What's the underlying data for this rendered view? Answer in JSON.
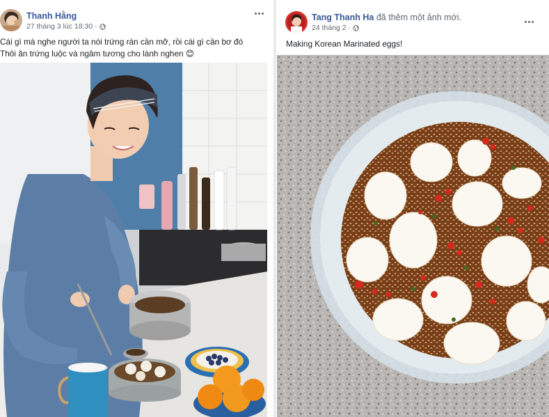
{
  "posts": [
    {
      "author": "Thanh Hằng",
      "action": "",
      "timestamp": "27 tháng 3 lúc 18:30",
      "separator": "·",
      "audience_icon": "globe-icon",
      "menu_icon": "more-options-icon",
      "caption_lines": [
        "Cái gì mà nghe người ta nói trứng rán cần mỡ, rồi cái gì cần bơ đó",
        "Thôi ăn trứng luộc và ngâm tương cho lành nghen 😊"
      ],
      "photo_icon": "kitchen-cooking-photo"
    },
    {
      "author": "Tang Thanh Ha",
      "action": "đã thêm một ảnh mới.",
      "timestamp": "24 tháng 2",
      "separator": "·",
      "audience_icon": "globe-icon",
      "menu_icon": "more-options-icon",
      "caption_lines": [
        "Making Korean Marinated eggs!"
      ],
      "photo_icon": "marinated-eggs-photo"
    }
  ],
  "colors": {
    "author_link": "#385898",
    "meta_text": "#606770",
    "body_text": "#1c1e21",
    "divider": "#e9ebee"
  }
}
